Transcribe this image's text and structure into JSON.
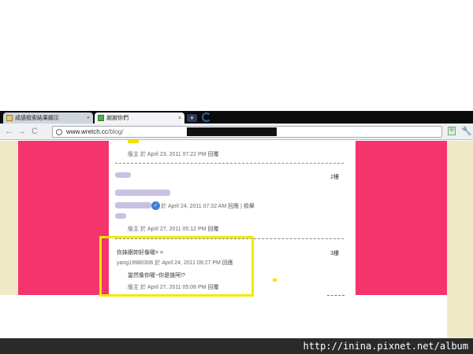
{
  "browser": {
    "tabs": [
      {
        "label": "成語檢索結果顯示",
        "favicon": "seal-favicon"
      },
      {
        "label": "謝謝你們",
        "favicon": "green-page-favicon"
      }
    ],
    "new_tab": "+",
    "close_glyph": "×",
    "back": "←",
    "forward": "→",
    "reload": "C",
    "url": {
      "host": "www.wretch.cc",
      "path": "/blog/"
    },
    "star": "☆",
    "extension": "ⓦ",
    "wrench": "🔧"
  },
  "comments": [
    {
      "meta": {
        "author": "版主",
        "sep": "於",
        "time": "April 23, 2011 07:22 PM",
        "reply": "回覆"
      }
    },
    {
      "floor": "2樓",
      "line": {
        "sep": "於",
        "time": "April 24, 2011 07:32 AM",
        "reply": "回應",
        "divider": "|",
        "report": "檢舉"
      },
      "meta": {
        "author": "版主",
        "sep": "於",
        "time": "April 27, 2011 05:12 PM",
        "reply": "回覆"
      }
    },
    {
      "floor": "3樓",
      "text": "你妹跟妳好像喔= =",
      "line": {
        "author": "yang19980306",
        "sep": "於",
        "time": "April 24, 2011 09:27 PM",
        "reply": "回應"
      },
      "reply_text": "當然像你喔~你是誰阿!?",
      "meta": {
        "author": "版主",
        "sep": "於",
        "time": "April 27, 2011 05:06 PM",
        "reply": "回覆"
      }
    }
  ],
  "watermark": "http://inina.pixnet.net/album",
  "colors": {
    "pink": "#f5336c",
    "cream": "#efe9c8",
    "highlight": "#f2ea00",
    "chrome": "#0b0b0b"
  }
}
